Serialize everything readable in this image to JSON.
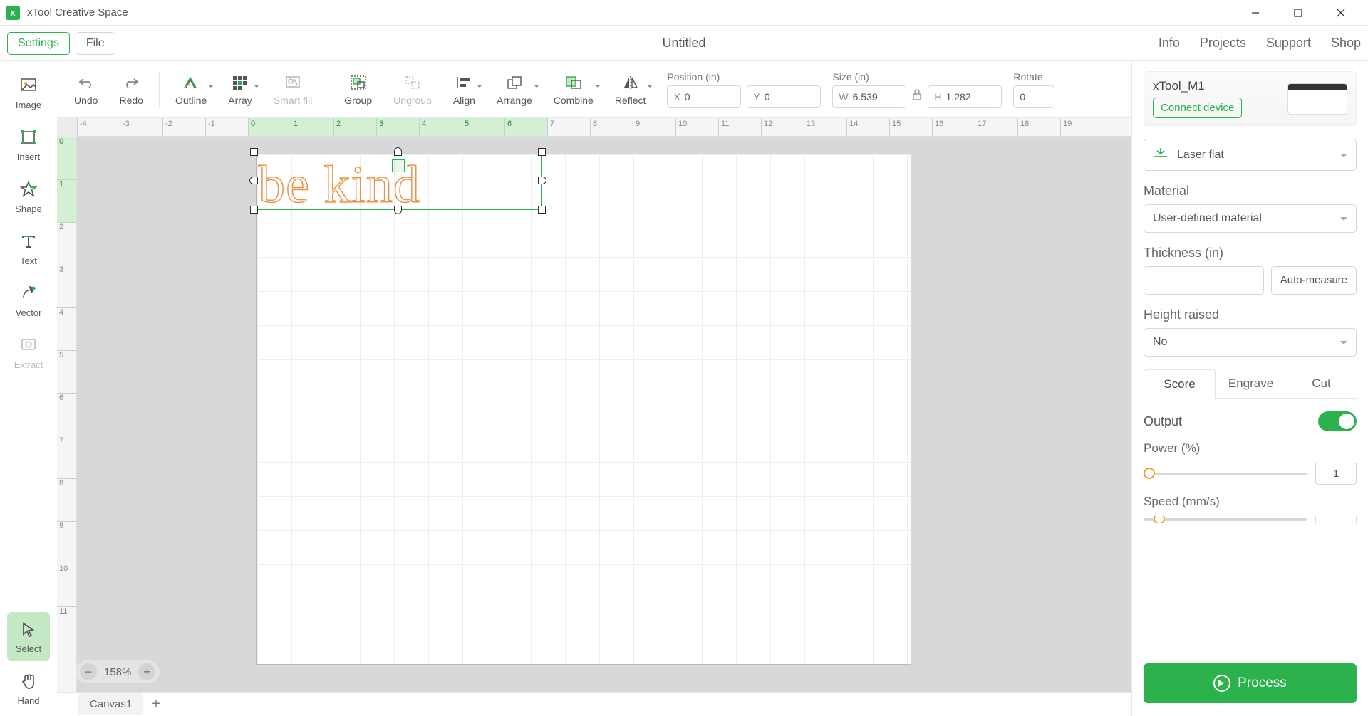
{
  "titlebar": {
    "app_name": "xTool Creative Space"
  },
  "menubar": {
    "settings": "Settings",
    "file": "File",
    "doc_title": "Untitled",
    "right": {
      "info": "Info",
      "projects": "Projects",
      "support": "Support",
      "shop": "Shop"
    }
  },
  "lrail": {
    "image": "Image",
    "insert": "Insert",
    "shape": "Shape",
    "text": "Text",
    "vector": "Vector",
    "extract": "Extract",
    "select": "Select",
    "hand": "Hand"
  },
  "toolbar": {
    "undo": "Undo",
    "redo": "Redo",
    "outline": "Outline",
    "array": "Array",
    "smartfill": "Smart fill",
    "group": "Group",
    "ungroup": "Ungroup",
    "align": "Align",
    "arrange": "Arrange",
    "combine": "Combine",
    "reflect": "Reflect"
  },
  "props": {
    "position_label": "Position (in)",
    "x_val": "0",
    "y_val": "0",
    "size_label": "Size (in)",
    "w_val": "6.539",
    "h_val": "1.282",
    "rotate_label": "Rotate",
    "rotate_val": "0"
  },
  "canvas": {
    "text_content": "be kind",
    "zoom": "158%",
    "tab_name": "Canvas1",
    "hruler": [
      "-4",
      "-3",
      "-2",
      "-1",
      "0",
      "1",
      "2",
      "3",
      "4",
      "5",
      "6",
      "7",
      "8",
      "9",
      "10",
      "11",
      "12",
      "13",
      "14",
      "15",
      "16",
      "17",
      "18",
      "19"
    ],
    "vruler": [
      "0",
      "1",
      "2",
      "3",
      "4",
      "5",
      "6",
      "7",
      "8",
      "9",
      "10",
      "11"
    ]
  },
  "rpanel": {
    "device_name": "xTool_M1",
    "connect": "Connect device",
    "mode": "Laser flat",
    "material_label": "Material",
    "material_val": "User-defined material",
    "thickness_label": "Thickness (in)",
    "auto_measure": "Auto-measure",
    "height_label": "Height raised",
    "height_val": "No",
    "tabs": {
      "score": "Score",
      "engrave": "Engrave",
      "cut": "Cut"
    },
    "output_label": "Output",
    "power_label": "Power (%)",
    "power_val": "1",
    "speed_label": "Speed (mm/s)",
    "process": "Process"
  }
}
